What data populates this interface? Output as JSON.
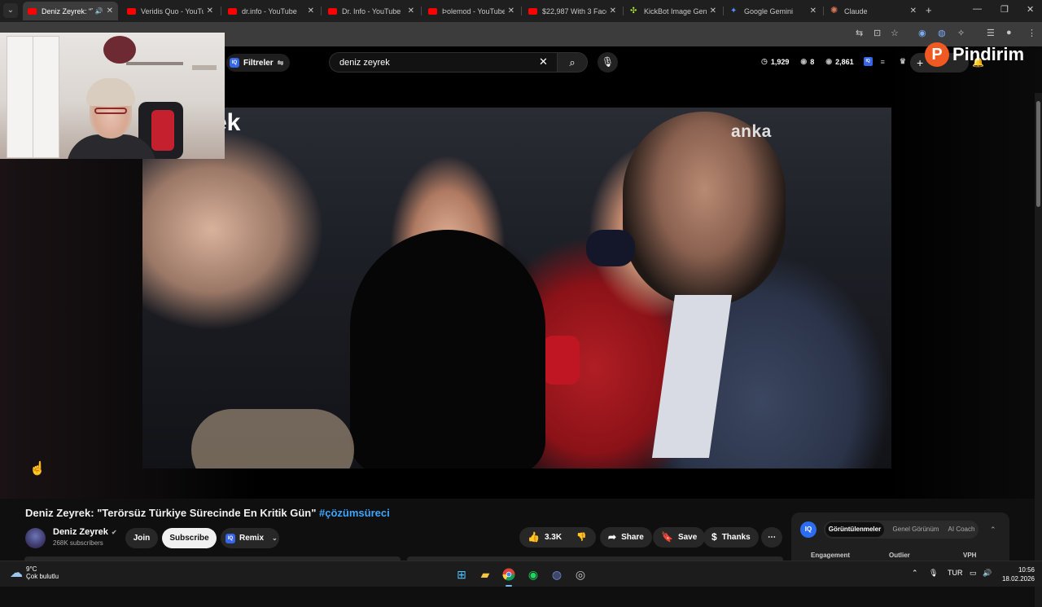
{
  "browser": {
    "tabs": [
      {
        "title": "Deniz Zeyrek: \"Te",
        "icon": "youtube-icon",
        "active": true
      },
      {
        "title": "Veridis Quo - YouTube",
        "icon": "youtube-icon"
      },
      {
        "title": "dr.info - YouTube",
        "icon": "youtube-icon"
      },
      {
        "title": "Dr. Info - YouTube",
        "icon": "youtube-icon"
      },
      {
        "title": "Þolemod - YouTube",
        "icon": "youtube-icon"
      },
      {
        "title": "$22,987 With 3 Faceless",
        "icon": "youtube-icon"
      },
      {
        "title": "KickBot Image Generator",
        "icon": "kickbot-icon"
      },
      {
        "title": "Google Gemini",
        "icon": "gemini-icon"
      },
      {
        "title": "Claude",
        "icon": "claude-icon"
      }
    ]
  },
  "youtube": {
    "filter_label": "Filtreler",
    "iq_badge": "IQ",
    "search_value": "deniz zeyrek",
    "stats": {
      "views": "1,929",
      "viewers": "8",
      "likes": "2,861"
    },
    "create_label": "+"
  },
  "overlay": {
    "logo_letter": "P",
    "logo_text": "Pindirim"
  },
  "video": {
    "watermark": "anka",
    "cut_text": "z\nek"
  },
  "info": {
    "title_main": "Deniz Zeyrek: \"Terörsüz Türkiye Sürecinde En Kritik Gün\"",
    "title_tag": "#çözümsüreci",
    "channel_name": "Deniz Zeyrek",
    "subscribers": "268K subscribers",
    "join_label": "Join",
    "subscribe_label": "Subscribe",
    "remix_label": "Remix",
    "like_count": "3.3K",
    "share_label": "Share",
    "save_label": "Save",
    "thanks_label": "Thanks"
  },
  "iq_panel": {
    "logo": "IQ",
    "tabs": [
      "Görüntülenmeler",
      "Genel Görünüm",
      "AI Coach"
    ],
    "columns": [
      "Engagement",
      "Outlier",
      "VPH"
    ]
  },
  "taskbar": {
    "weather_temp": "9°C",
    "weather_desc": "Çok bulutlu",
    "language": "TUR",
    "time": "10:56",
    "date": "18.02.2026"
  }
}
